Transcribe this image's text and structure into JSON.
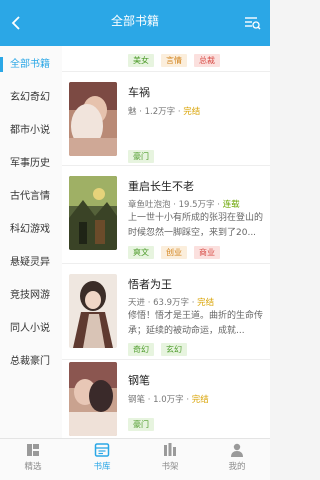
{
  "header": {
    "title": "全部书籍"
  },
  "sidebar": {
    "items": [
      {
        "label": "全部书籍",
        "active": true
      },
      {
        "label": "玄幻奇幻"
      },
      {
        "label": "都市小说"
      },
      {
        "label": "军事历史"
      },
      {
        "label": "古代言情"
      },
      {
        "label": "科幻游戏"
      },
      {
        "label": "悬疑灵异"
      },
      {
        "label": "竞技网游"
      },
      {
        "label": "同人小说"
      },
      {
        "label": "总裁豪门"
      }
    ]
  },
  "partial_book": {
    "tags": [
      "美女",
      "言情",
      "总裁"
    ]
  },
  "books": [
    {
      "title": "车祸",
      "author": "魅",
      "words": "1.2万字",
      "status": "完结",
      "tags": [
        "豪门"
      ]
    },
    {
      "title": "重启长生不老",
      "author": "章鱼吐泡泡",
      "words": "19.5万字",
      "status": "连载",
      "desc": "上一世十小有所成的张羽在登山的时候忽然一脚踩空，来到了20...",
      "tags": [
        "爽文",
        "创业",
        "商业"
      ]
    },
    {
      "title": "悟者为王",
      "author": "天进",
      "words": "63.9万字",
      "status": "完结",
      "desc": "修悟！悟才是王道。曲折的生命传承；延续的被动命运，成就...",
      "tags": [
        "奇幻",
        "玄幻"
      ]
    },
    {
      "title": "钢笔",
      "author": "钢笔",
      "words": "1.0万字",
      "status": "完结",
      "tags": [
        "豪门"
      ]
    }
  ],
  "tabbar": {
    "tabs": [
      {
        "label": "精选",
        "icon": "featured-icon"
      },
      {
        "label": "书库",
        "icon": "library-icon",
        "active": true
      },
      {
        "label": "书架",
        "icon": "bookshelf-icon"
      },
      {
        "label": "我的",
        "icon": "profile-icon"
      }
    ]
  },
  "colors": {
    "accent": "#2ba7e6",
    "status_done": "#d8a200",
    "status_serial": "#6aa500"
  }
}
